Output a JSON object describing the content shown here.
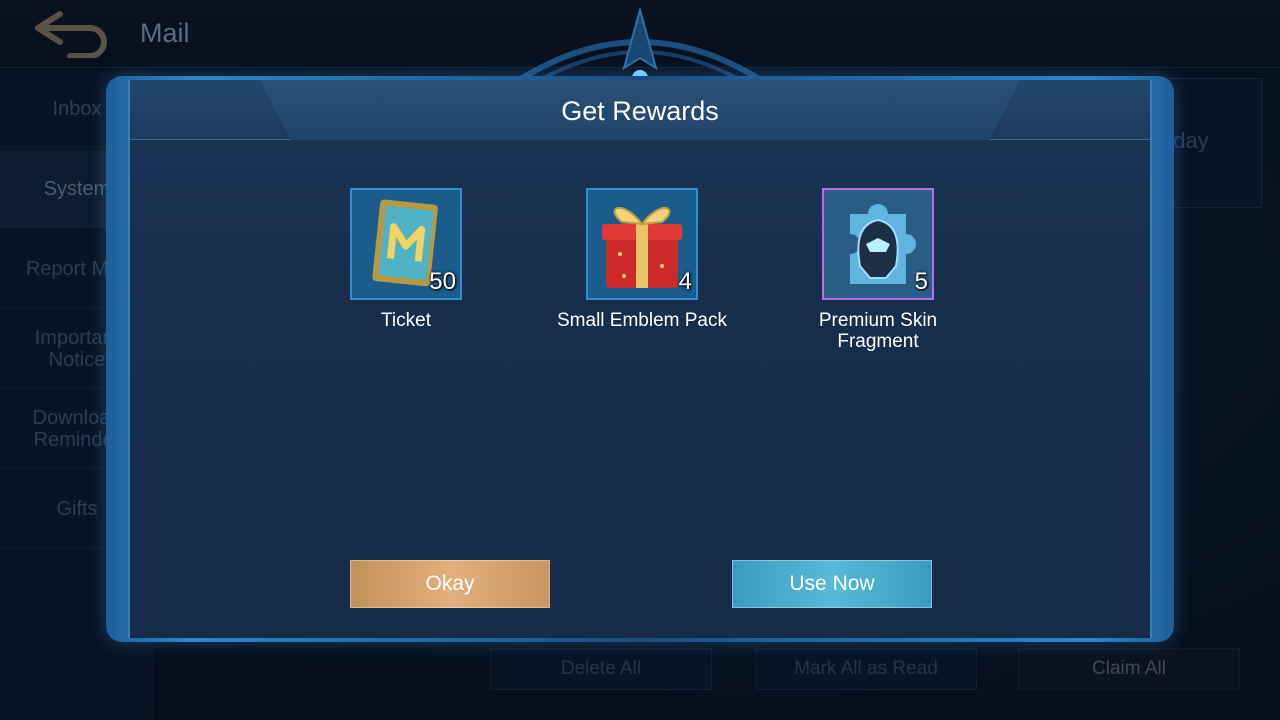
{
  "header": {
    "title": "Mail",
    "back_icon": "back-arrow-icon"
  },
  "sidebar": {
    "items": [
      {
        "label": "Inbox",
        "active": false
      },
      {
        "label": "System",
        "active": true
      },
      {
        "label": "Report Mail",
        "active": false
      },
      {
        "label": "Important Notice",
        "active": false
      },
      {
        "label": "Download Reminder",
        "active": false
      },
      {
        "label": "Gifts",
        "active": false
      }
    ]
  },
  "mail_list": {
    "date_text": "Today"
  },
  "actions": {
    "delete_all": "Delete All",
    "mark_all_read": "Mark All as Read",
    "claim_all": "Claim All"
  },
  "dialog": {
    "title": "Get Rewards",
    "rewards": [
      {
        "name": "Ticket",
        "quantity": "50",
        "icon": "ticket-icon",
        "rarity_color": "#3390d0"
      },
      {
        "name": "Small Emblem Pack",
        "quantity": "4",
        "icon": "gift-box-icon",
        "rarity_color": "#3390d0"
      },
      {
        "name": "Premium Skin Fragment",
        "quantity": "5",
        "icon": "skin-fragment-icon",
        "rarity_color": "#b46ee6"
      }
    ],
    "okay_label": "Okay",
    "use_now_label": "Use Now"
  },
  "colors": {
    "okay_button": "#d8a46e",
    "use_now_button": "#4aaed0",
    "frame_accent": "#2d86c9"
  }
}
